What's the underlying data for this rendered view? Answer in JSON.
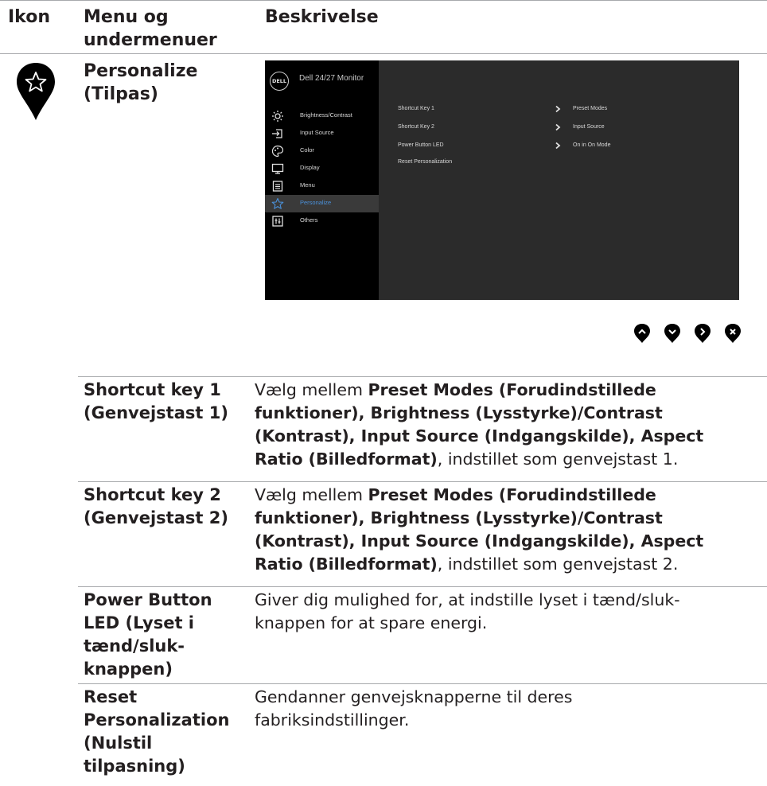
{
  "header": {
    "col_icon": "Ikon",
    "col_menu_line1": "Menu og",
    "col_menu_line2": "undermenuer",
    "col_desc": "Beskrivelse"
  },
  "section": {
    "icon": "star-icon",
    "title_line1": "Personalize",
    "title_line2": "(Tilpas)"
  },
  "osd": {
    "logo": "DELL",
    "title": "Dell 24/27 Monitor",
    "menu_items": [
      {
        "label": "Brightness/Contrast",
        "icon": "sun-icon"
      },
      {
        "label": "Input Source",
        "icon": "input-icon"
      },
      {
        "label": "Color",
        "icon": "palette-icon"
      },
      {
        "label": "Display",
        "icon": "monitor-icon"
      },
      {
        "label": "Menu",
        "icon": "menu-icon"
      },
      {
        "label": "Personalize",
        "icon": "star-icon",
        "active": true
      },
      {
        "label": "Others",
        "icon": "others-icon"
      }
    ],
    "rows": [
      {
        "label": "Shortcut Key 1",
        "value": "Preset Modes"
      },
      {
        "label": "Shortcut Key 2",
        "value": "Input Source"
      },
      {
        "label": "Power Button LED",
        "value": "On in On Mode"
      },
      {
        "label": "Reset Personalization",
        "value": ""
      }
    ],
    "accent": "#4a90d9"
  },
  "nav_buttons": [
    "up-icon",
    "down-icon",
    "right-icon",
    "close-icon"
  ],
  "rows": [
    {
      "label_lines": [
        "Shortcut key 1",
        "(Genvejstast 1)"
      ],
      "desc_prefix": "Vælg mellem ",
      "desc_lines_bold": [
        "Preset Modes (Forudindstillede",
        "funktioner), Brightness (Lysstyrke)/Contrast",
        "(Kontrast), Input Source (Indgangskilde), Aspect",
        "Ratio (Billedformat)"
      ],
      "desc_suffix": ", indstillet som genvejstast 1."
    },
    {
      "label_lines": [
        "Shortcut key 2",
        "(Genvejstast 2)"
      ],
      "desc_prefix": "Vælg mellem ",
      "desc_lines_bold": [
        "Preset Modes (Forudindstillede",
        "funktioner), Brightness (Lysstyrke)/Contrast",
        "(Kontrast), Input Source (Indgangskilde), Aspect",
        "Ratio (Billedformat)"
      ],
      "desc_suffix": ", indstillet som genvejstast 2."
    },
    {
      "label_lines": [
        "Power Button",
        "LED (Lyset i",
        "tænd/sluk-",
        "knappen)"
      ],
      "desc_lines": [
        "Giver dig mulighed for, at indstille lyset i tænd/sluk-",
        "knappen for at spare energi."
      ]
    },
    {
      "label_lines": [
        "Reset",
        "Personalization",
        "(Nulstil",
        "tilpasning)"
      ],
      "desc_lines": [
        "Gendanner genvejsknapperne til deres",
        "fabriksindstillinger."
      ]
    }
  ]
}
